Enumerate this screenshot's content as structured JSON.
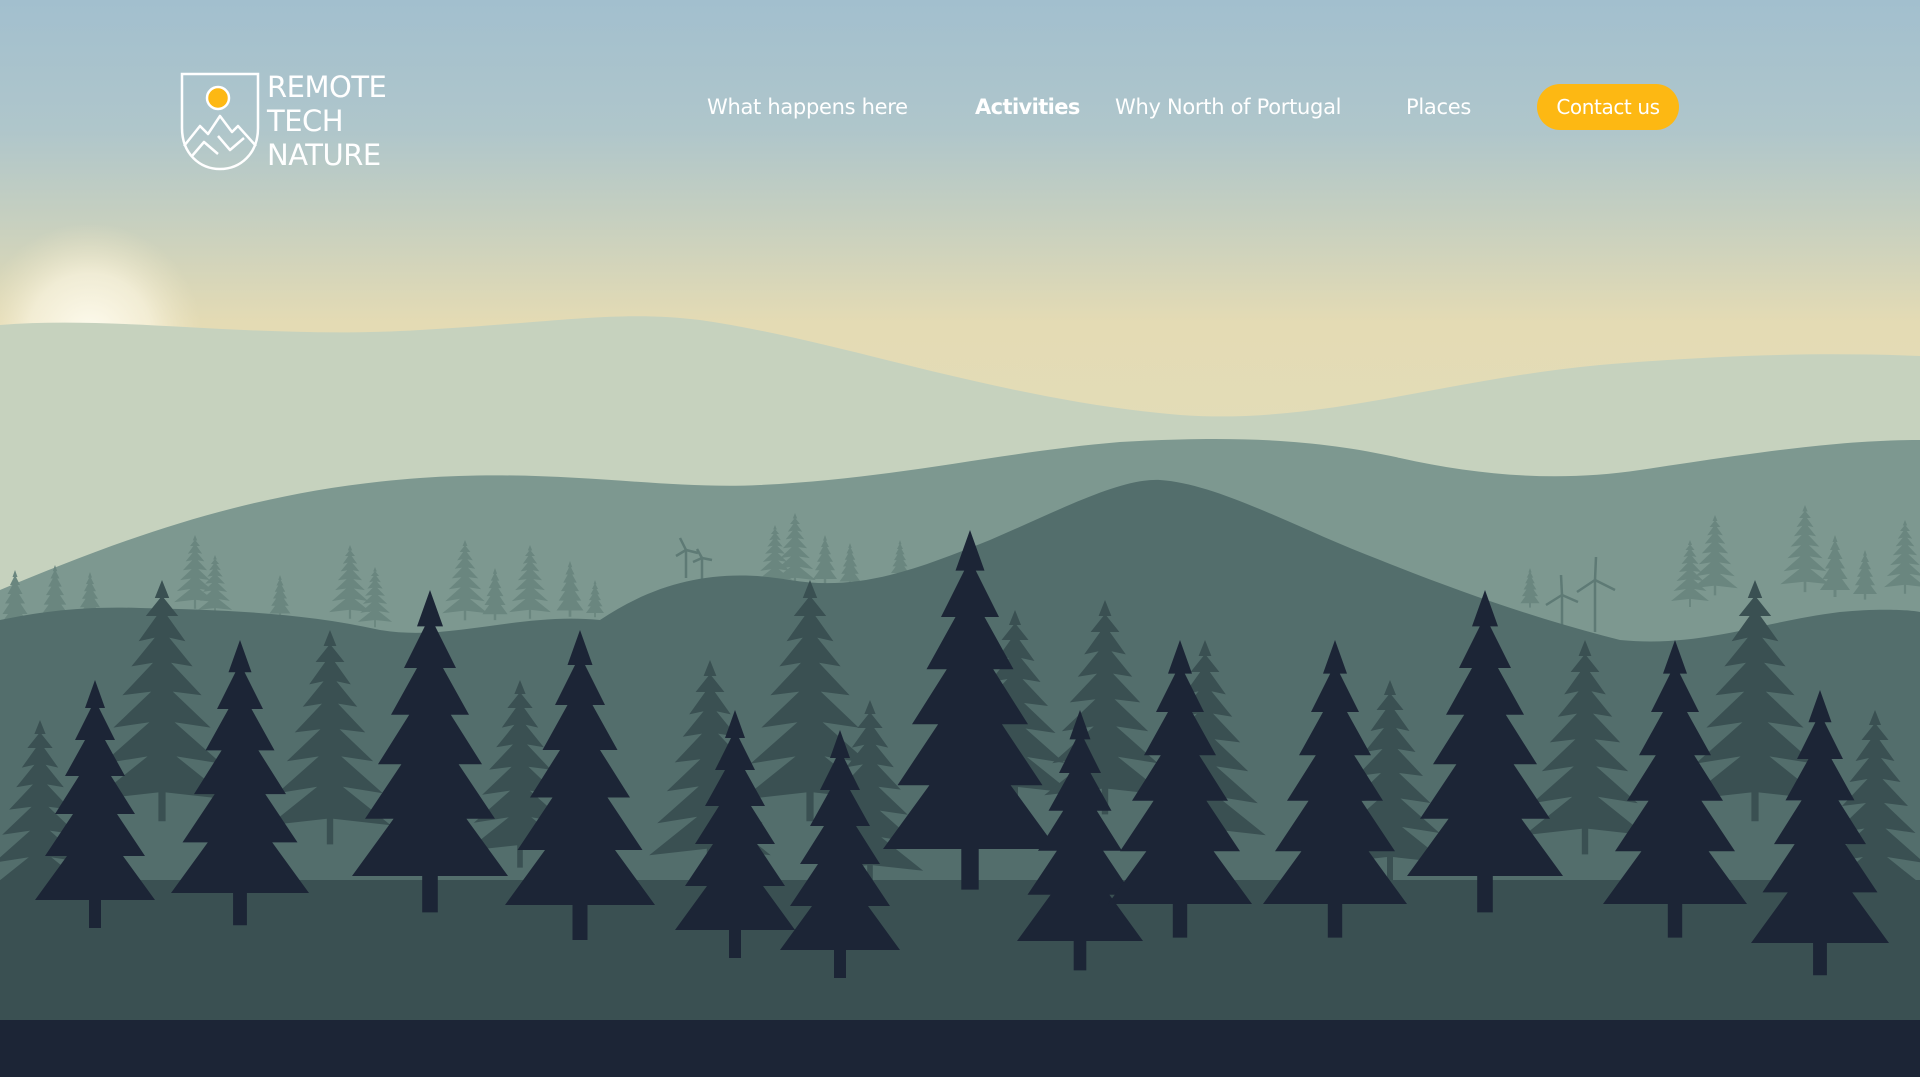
{
  "brand": {
    "logo_lines": [
      "REMOTE",
      "TECH",
      "NATURE"
    ],
    "sun_color": "#FDB813"
  },
  "nav": {
    "items": [
      {
        "label": "What happens here",
        "active": false
      },
      {
        "label": "Activities",
        "active": true
      },
      {
        "label": "Why North of Portugal",
        "active": false
      },
      {
        "label": "Places",
        "active": false
      }
    ],
    "cta_label": "Contact us"
  },
  "colors": {
    "accent": "#FDB813",
    "sky_top": "#A2BFCE",
    "sky_horizon": "#E4DBB4",
    "hill_far": "#C6D2BE",
    "hill_mid": "#7D9890",
    "hill_near": "#536E6C",
    "forest_mid": "#3A5052",
    "forest_front": "#1C2536"
  }
}
